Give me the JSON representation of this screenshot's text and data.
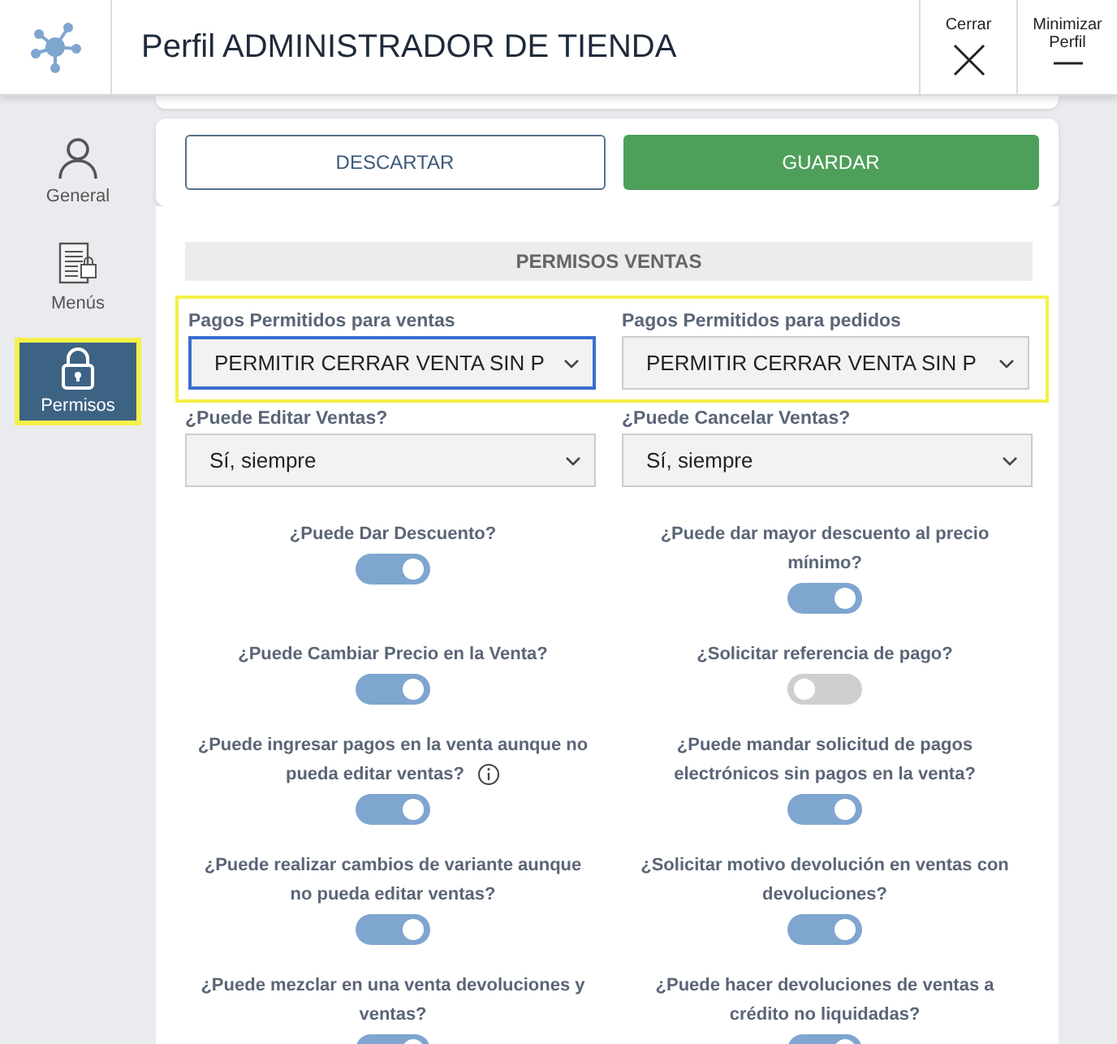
{
  "header": {
    "title": "Perfil ADMINISTRADOR DE TIENDA",
    "close_label": "Cerrar",
    "minimize_label": "Minimizar Perfil"
  },
  "sidebar": {
    "items": [
      {
        "kind": "person",
        "label": "General",
        "selected": false
      },
      {
        "kind": "document",
        "label": "Menús",
        "selected": false
      },
      {
        "kind": "lock",
        "label": "Permisos",
        "selected": true
      }
    ]
  },
  "actions": {
    "discard": "DESCARTAR",
    "save": "GUARDAR"
  },
  "section": {
    "title": "PERMISOS VENTAS"
  },
  "highlighted_group": {
    "highlighted": true,
    "fields": [
      {
        "label": "Pagos Permitidos para ventas",
        "value": "PERMITIR CERRAR VENTA SIN P",
        "focused": true
      },
      {
        "label": "Pagos Permitidos para pedidos",
        "value": "PERMITIR CERRAR VENTA SIN P",
        "focused": false
      }
    ]
  },
  "selects": [
    {
      "label": "¿Puede Editar Ventas?",
      "value": "Sí, siempre",
      "focused": false
    },
    {
      "label": "¿Puede Cancelar Ventas?",
      "value": "Sí, siempre",
      "focused": false
    }
  ],
  "toggles": [
    {
      "label": "¿Puede Dar Descuento?",
      "on": true,
      "info": false
    },
    {
      "label": "¿Puede dar mayor descuento al precio mínimo?",
      "on": true,
      "info": false
    },
    {
      "label": "¿Puede Cambiar Precio en la Venta?",
      "on": true,
      "info": false
    },
    {
      "label": "¿Solicitar referencia de pago?",
      "on": false,
      "info": false
    },
    {
      "label": "¿Puede ingresar pagos en la venta aunque no pueda editar ventas?",
      "on": true,
      "info": true
    },
    {
      "label": "¿Puede mandar solicitud de pagos electrónicos sin pagos en la venta?",
      "on": true,
      "info": false
    },
    {
      "label": "¿Puede realizar cambios de variante aunque no pueda editar ventas?",
      "on": true,
      "info": false
    },
    {
      "label": "¿Solicitar motivo devolución en ventas con devoluciones?",
      "on": true,
      "info": false
    },
    {
      "label": "¿Puede mezclar en una venta devoluciones y ventas?",
      "on": true,
      "info": false
    },
    {
      "label": "¿Puede hacer devoluciones de ventas a crédito no liquidadas?",
      "on": true,
      "info": false
    }
  ]
}
